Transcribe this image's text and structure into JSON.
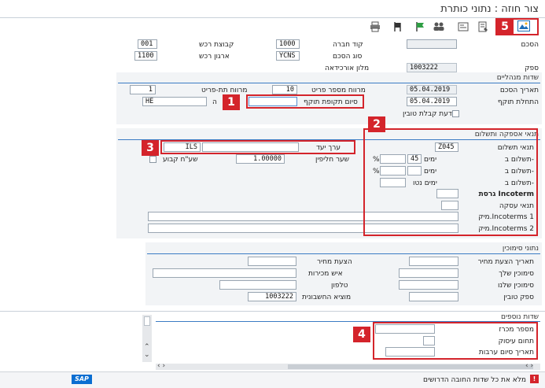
{
  "window": {
    "title": "צור חוזה : נתוני כותרת"
  },
  "toolbar": {
    "icons": [
      "mountain-image-icon",
      "document-edit-icon",
      "form-icon",
      "people-icon",
      "flag-icon",
      "flag-green-icon",
      "printer-icon"
    ]
  },
  "header": {
    "agreement_label": "הסכם",
    "company_code_label": "קוד חברה",
    "company_code": "1000",
    "purch_group_label": "קבוצת רכש",
    "purch_group": "001",
    "agreement_type_label": "סוג הסכם",
    "agreement_type": "YCNS",
    "purch_org_label": "ארגון רכש",
    "purch_org": "1100",
    "vendor_label": "ספק",
    "vendor": "1003222",
    "vendor_name": "מלון אורכידאה"
  },
  "admin": {
    "section_title": "שדות מנהליים",
    "agreement_date_label": "תאריך הסכם",
    "agreement_date": "05.04.2019",
    "item_interval_label": "מרווח מספר פריט",
    "item_interval": "10",
    "subitem_interval_label": "מרווח תת-פריט",
    "subitem_interval": "1",
    "validity_start_label": "התחלת תוקף",
    "validity_start": "05.04.2019",
    "validity_end_label": "סיום תקופת תוקף",
    "language_short": "ה",
    "language": "HE",
    "gr_message_label": "הודעת קבלת טובין"
  },
  "terms": {
    "section_title": "תנאי אספקה ותשלום",
    "payment_terms_label": "תנאי תשלום",
    "payment_terms": "Z045",
    "payment_in_label": "תשלום ב-",
    "days_label": "ימים",
    "days_1": "45",
    "percent_sign": "%",
    "net_days_label": "ימים נטו",
    "incoterm_version_label": "גרסת Incoterm",
    "deal_terms_label": "תנאי עסקה",
    "incoterms_loc1_label": "מיק.Incoterms 1",
    "incoterms_loc2_label": "מיק.Incoterms 2",
    "currency_label": "ערך יעד",
    "currency": "ILS",
    "exchange_rate_label": "שער חליפין",
    "exchange_rate": "1.00000",
    "fixed_rate_label": "שע\"ח קבוע"
  },
  "reference": {
    "section_title": "נתוני סימוכין",
    "quote_date_label": "תאריך הצעת מחיר",
    "quote_label": "הצעת מחיר",
    "your_ref_label": "סימוכין שלך",
    "salesperson_label": "איש מכירות",
    "our_ref_label": "סימוכין שלנו",
    "phone_label": "טלפון",
    "supplying_vendor_label": "ספק טובין",
    "invoicing_party_label": "מוציא החשבונית",
    "invoicing_party": "1003222"
  },
  "additional": {
    "section_title": "שדות נוספים",
    "tender_no_label": "מספר מכרז",
    "business_area_label": "תחום עיסוק",
    "guarantee_end_label": "תאריך סיום ערבות"
  },
  "status": {
    "message": "מלא את כל שדות החובה הדרושים",
    "sap_logo": "SAP"
  },
  "annotations": [
    "1",
    "2",
    "3",
    "4",
    "5"
  ],
  "colors": {
    "accent_red": "#d4242b",
    "sap_blue": "#0a6ed1",
    "section_line": "#3b7cc4"
  }
}
